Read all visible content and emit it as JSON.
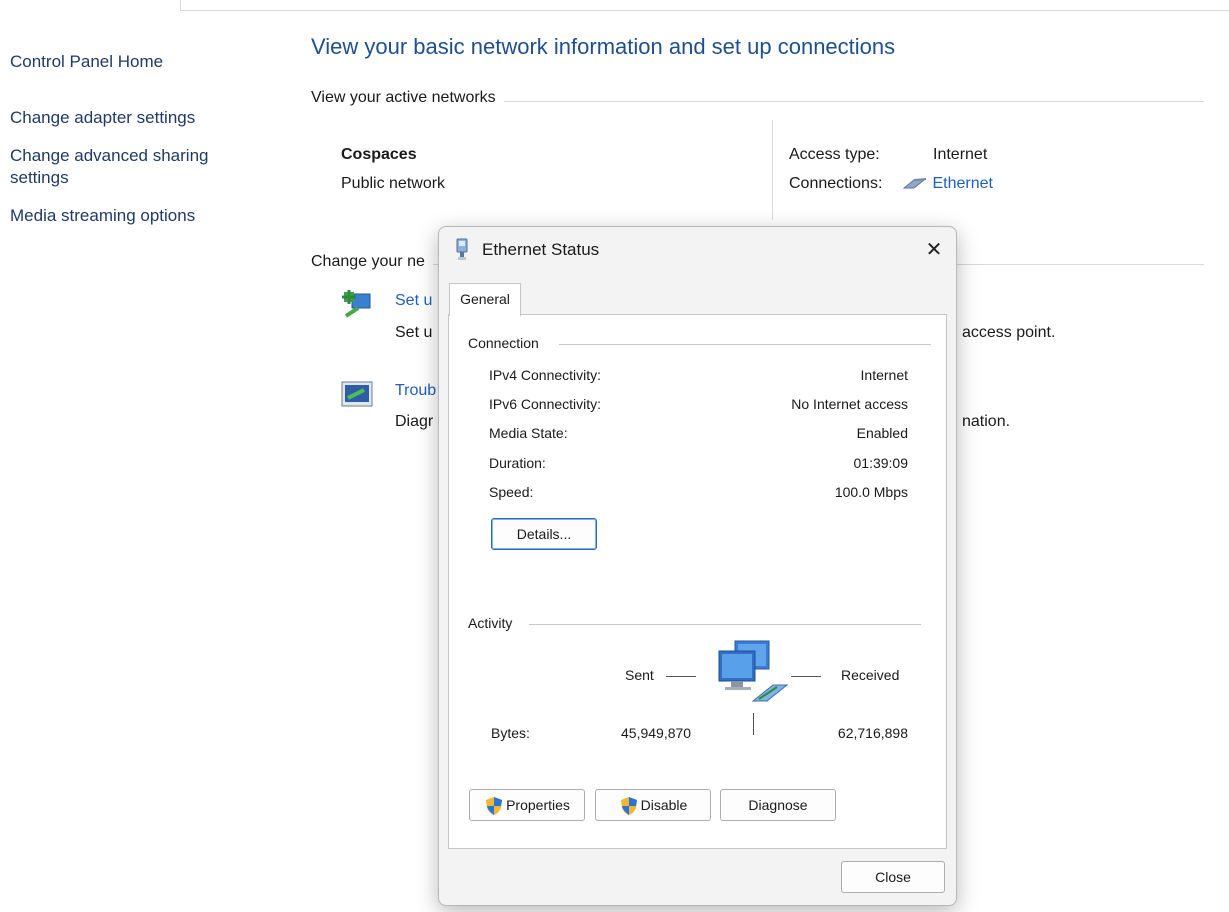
{
  "sidebar": {
    "home": "Control Panel Home",
    "items": [
      "Change adapter settings",
      "Change advanced sharing settings",
      "Media streaming options"
    ]
  },
  "main": {
    "title": "View your basic network information and set up connections",
    "active_networks_header": "View your active networks",
    "network": {
      "name": "Cospaces",
      "type": "Public network",
      "access_type_label": "Access type:",
      "access_type_value": "Internet",
      "connections_label": "Connections:",
      "connections_value": "Ethernet"
    },
    "change_header": "Change your ne",
    "tasks": [
      {
        "link": "Set u",
        "desc": "Set u",
        "desc_right": "access point."
      },
      {
        "link": "Troub",
        "desc": "Diagr",
        "desc_right": "nation."
      }
    ]
  },
  "dialog": {
    "title": "Ethernet Status",
    "close_glyph": "✕",
    "tab": "General",
    "connection": {
      "header": "Connection",
      "rows": [
        {
          "label": "IPv4 Connectivity:",
          "value": "Internet"
        },
        {
          "label": "IPv6 Connectivity:",
          "value": "No Internet access"
        },
        {
          "label": "Media State:",
          "value": "Enabled"
        },
        {
          "label": "Duration:",
          "value": "01:39:09"
        },
        {
          "label": "Speed:",
          "value": "100.0 Mbps"
        }
      ],
      "details_button": "Details..."
    },
    "activity": {
      "header": "Activity",
      "sent_label": "Sent",
      "received_label": "Received",
      "bytes_label": "Bytes:",
      "bytes_sent": "45,949,870",
      "bytes_received": "62,716,898"
    },
    "buttons": {
      "properties": "Properties",
      "disable": "Disable",
      "diagnose": "Diagnose",
      "close": "Close"
    }
  },
  "colors": {
    "link": "#1f5fbf",
    "title": "#1e4f91",
    "dialog_bg": "#f3f3f3"
  }
}
